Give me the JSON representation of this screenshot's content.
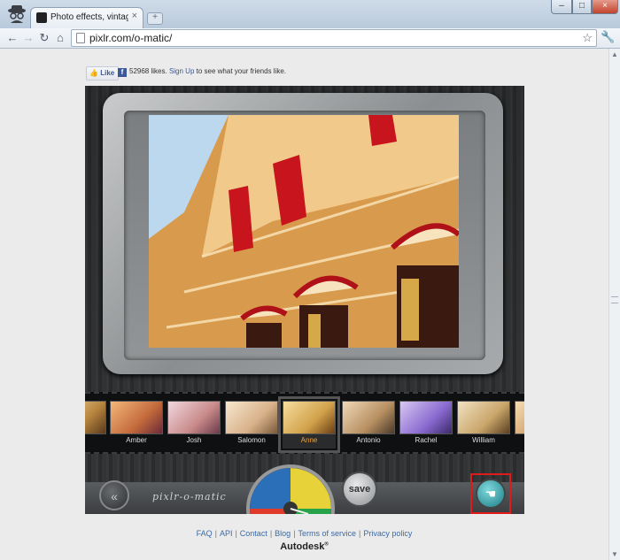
{
  "browser": {
    "tab_title": "Photo effects, vintage, retr",
    "tab_close": "×",
    "new_tab": "+",
    "window_buttons": {
      "minimize": "–",
      "maximize": "□",
      "close": "×"
    },
    "nav": {
      "back": "←",
      "forward": "→",
      "reload": "↻",
      "home": "⌂"
    },
    "url": "pixlr.com/o-matic/",
    "bookmark_icon": "☆",
    "menu_icon": "🔧"
  },
  "facebook": {
    "like_label": "Like",
    "logo": "f",
    "likes_count": "52968 likes.",
    "signup_link": "Sign Up",
    "signup_tail": "to see what your friends like."
  },
  "app": {
    "effects": [
      {
        "name": "",
        "partial": true,
        "tint": "#b8863f"
      },
      {
        "name": "Amber",
        "tint": "#c46a3b"
      },
      {
        "name": "Josh",
        "tint": "#c98a8a"
      },
      {
        "name": "Salomon",
        "tint": "#d9b28a"
      },
      {
        "name": "Anne",
        "tint": "#d2a24b",
        "selected": true
      },
      {
        "name": "Antonio",
        "tint": "#b89062"
      },
      {
        "name": "Rachel",
        "tint": "#8a6ad0"
      },
      {
        "name": "William",
        "tint": "#c9a56a"
      },
      {
        "name": "",
        "partial": true,
        "tint": "#d0a068"
      }
    ],
    "back_icon": "«",
    "logo_text": "pixlr-o-matic",
    "save_label": "save",
    "go_icon": "☚",
    "dial_colors": [
      "#2b6fb8",
      "#e03a2a",
      "#e8d23a",
      "#27a34a"
    ]
  },
  "footer": {
    "links": [
      "FAQ",
      "API",
      "Contact",
      "Blog",
      "Terms of service",
      "Privacy policy"
    ],
    "separator": "|",
    "brand": "Autodesk",
    "brand_mark": "®"
  }
}
